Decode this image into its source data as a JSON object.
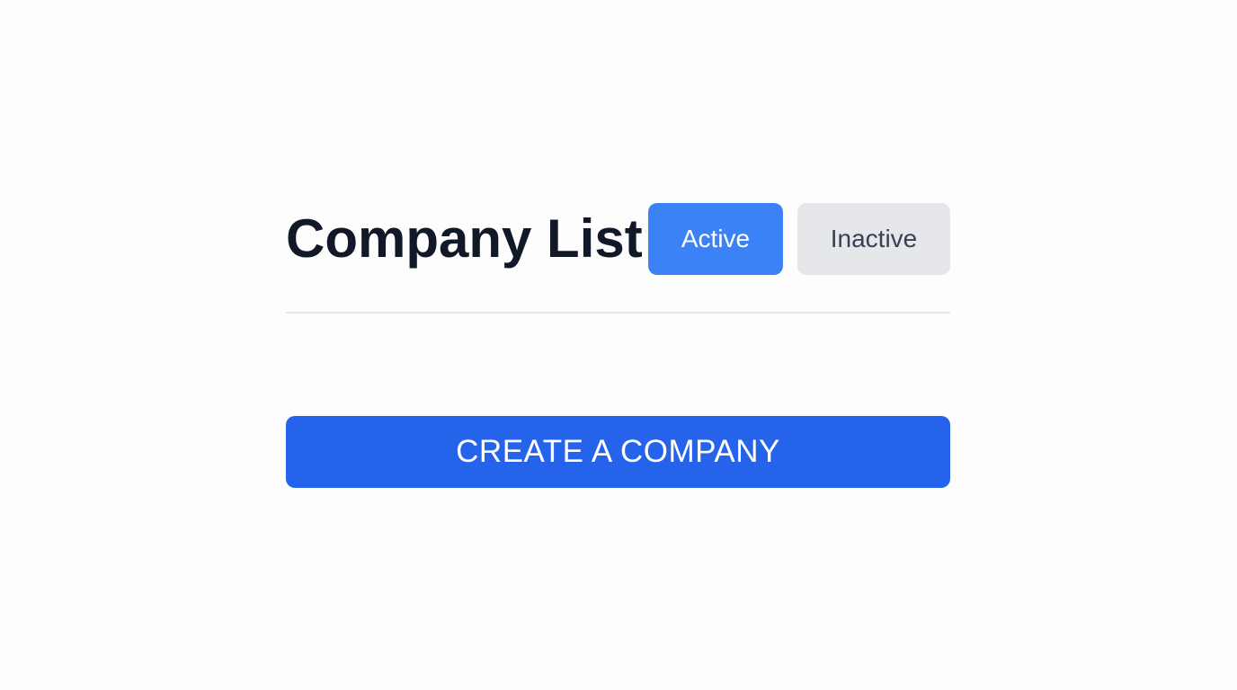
{
  "header": {
    "title": "Company List"
  },
  "filters": {
    "active_label": "Active",
    "inactive_label": "Inactive",
    "selected": "Active"
  },
  "actions": {
    "create_label": "CREATE A COMPANY"
  },
  "colors": {
    "active_button": "#3b82f6",
    "inactive_button": "#e5e7eb",
    "primary_button": "#2563eb",
    "title_text": "#111827"
  }
}
